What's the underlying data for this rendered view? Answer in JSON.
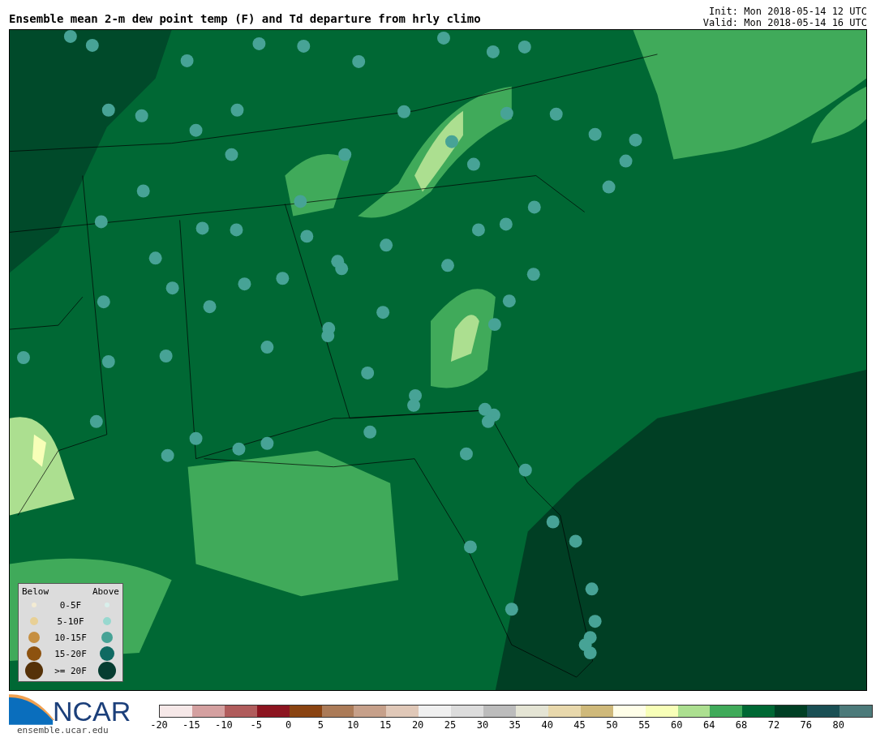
{
  "title": "Ensemble mean 2-m dew point temp (F) and Td departure from hrly climo",
  "init": "Init: Mon 2018-05-14 12 UTC",
  "valid": "Valid: Mon 2018-05-14 16 UTC",
  "legend": {
    "below_label": "Below",
    "above_label": "Above",
    "rows": [
      {
        "label": "0-5F",
        "below": {
          "color": "#f3ebd3"
        },
        "above": {
          "color": "#d8efeb"
        }
      },
      {
        "label": "5-10F",
        "below": {
          "color": "#e8d096"
        },
        "above": {
          "color": "#98d8cf"
        }
      },
      {
        "label": "10-15F",
        "below": {
          "color": "#c68f41"
        },
        "above": {
          "color": "#47a396"
        }
      },
      {
        "label": "15-20F",
        "below": {
          "color": "#8d520f"
        },
        "above": {
          "color": "#0f6a62"
        }
      },
      {
        "label": ">= 20F",
        "below": {
          "color": "#553108"
        },
        "above": {
          "color": "#063d31"
        }
      }
    ]
  },
  "logo": {
    "text": "NCAR",
    "url": "ensemble.ucar.edu"
  },
  "colorbar": {
    "segments": [
      {
        "color": "#f6e8e8"
      },
      {
        "color": "#d4a0a0"
      },
      {
        "color": "#b05c5c"
      },
      {
        "color": "#8c1520"
      },
      {
        "color": "#8a4412"
      },
      {
        "color": "#ab7b58"
      },
      {
        "color": "#c6a08a"
      },
      {
        "color": "#e0c8b8"
      },
      {
        "color": "#f0f0f0"
      },
      {
        "color": "#dcdcdc"
      },
      {
        "color": "#bcbcbc"
      },
      {
        "color": "#e4e4d4"
      },
      {
        "color": "#e8d8ac"
      },
      {
        "color": "#cfb97a"
      },
      {
        "color": "#fffee8"
      },
      {
        "color": "#f8ffb8"
      },
      {
        "color": "#acdf90"
      },
      {
        "color": "#40aa5a"
      },
      {
        "color": "#006834"
      },
      {
        "color": "#003f24"
      },
      {
        "color": "#1a4f54"
      },
      {
        "color": "#4c7a7a"
      }
    ],
    "ticks": [
      "-20",
      "-15",
      "-10",
      "-5",
      "0",
      "5",
      "10",
      "15",
      "20",
      "25",
      "30",
      "35",
      "40",
      "45",
      "50",
      "55",
      "60",
      "64",
      "68",
      "72",
      "76",
      "80"
    ]
  }
}
